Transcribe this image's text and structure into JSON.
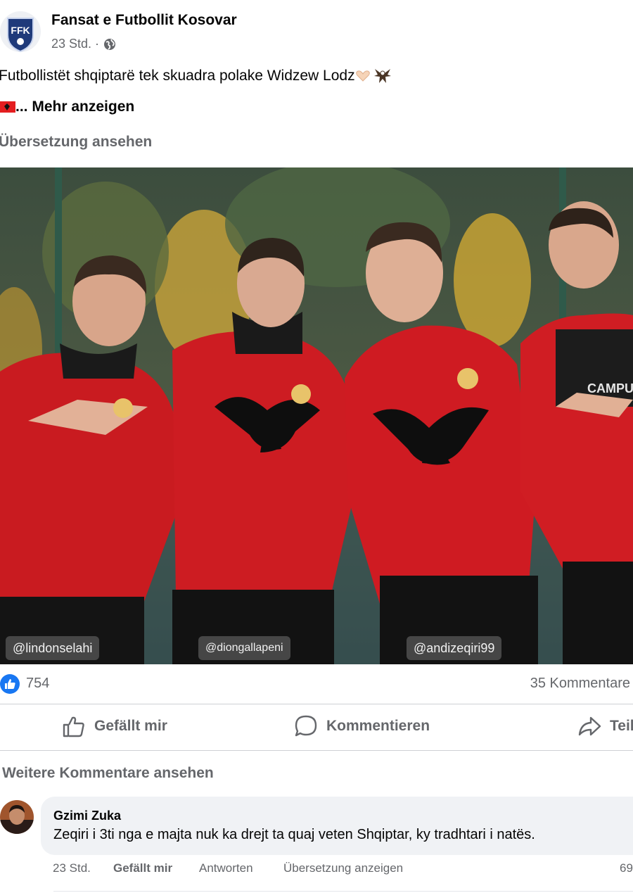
{
  "post": {
    "page_name": "Fansat e Futbollit Kosovar",
    "avatar_initials": "FFK",
    "time": "23 Std. ·",
    "privacy_icon": "globe-icon",
    "text": "Futbollistët shqiptarë tek skuadra polake Widzew Lodz",
    "see_more": "... Mehr anzeigen",
    "translate": "Übersetzung ansehen"
  },
  "photo": {
    "tags": [
      "@lindonselahi",
      "@diongallapeni",
      "@andizeqiri99"
    ],
    "sponsor": "CAMPU"
  },
  "stats": {
    "likes": "754",
    "comments": "35 Kommentare"
  },
  "actions": {
    "like": "Gefällt mir",
    "comment": "Kommentieren",
    "share": "Teilen"
  },
  "comments": {
    "more": "Weitere Kommentare ansehen",
    "items": [
      {
        "author": "Gzimi Zuka",
        "text": "Zeqiri i 3ti nga e majta nuk ka drejt ta quaj veten Shqiptar, ky tradhtari i natës.",
        "time": "23 Std.",
        "like": "Gefällt mir",
        "reply": "Antworten",
        "translate": "Übersetzung anzeigen",
        "reactions": "69"
      }
    ]
  },
  "colors": {
    "accent": "#1877f2",
    "muted": "#65676b",
    "jacket": "#d4141e"
  }
}
